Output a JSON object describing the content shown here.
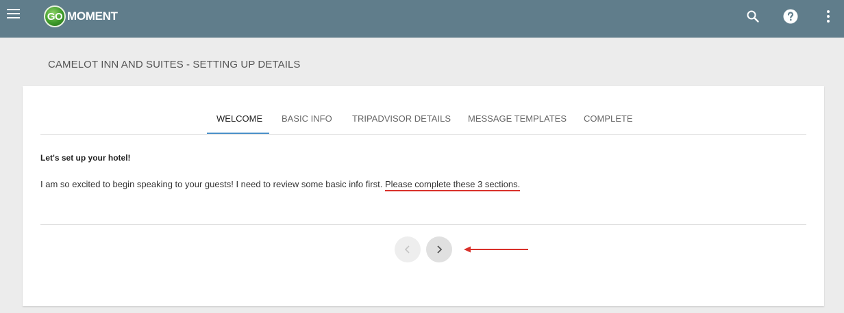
{
  "header": {
    "logo_go": "GO",
    "logo_text": "MOMENT",
    "menu_icon": "hamburger-menu-icon",
    "search_icon": "search-icon",
    "help_icon": "help-icon",
    "more_icon": "more-vertical-icon",
    "color": "#607d8b"
  },
  "page": {
    "title": "CAMELOT INN AND SUITES - SETTING UP DETAILS"
  },
  "tabs": [
    {
      "label": "WELCOME",
      "active": true
    },
    {
      "label": "BASIC INFO",
      "active": false
    },
    {
      "label": "TRIPADVISOR DETAILS",
      "active": false
    },
    {
      "label": "MESSAGE TEMPLATES",
      "active": false
    },
    {
      "label": "COMPLETE",
      "active": false
    }
  ],
  "content": {
    "heading": "Let's set up your hotel!",
    "text": "I am so excited to begin speaking to your guests! I need to review some basic info first. ",
    "highlight": "Please complete these 3 sections."
  },
  "nav": {
    "prev_icon": "chevron-left-icon",
    "next_icon": "chevron-right-icon"
  },
  "colors": {
    "accent": "#4a90c8",
    "annotation": "#d9302a"
  }
}
